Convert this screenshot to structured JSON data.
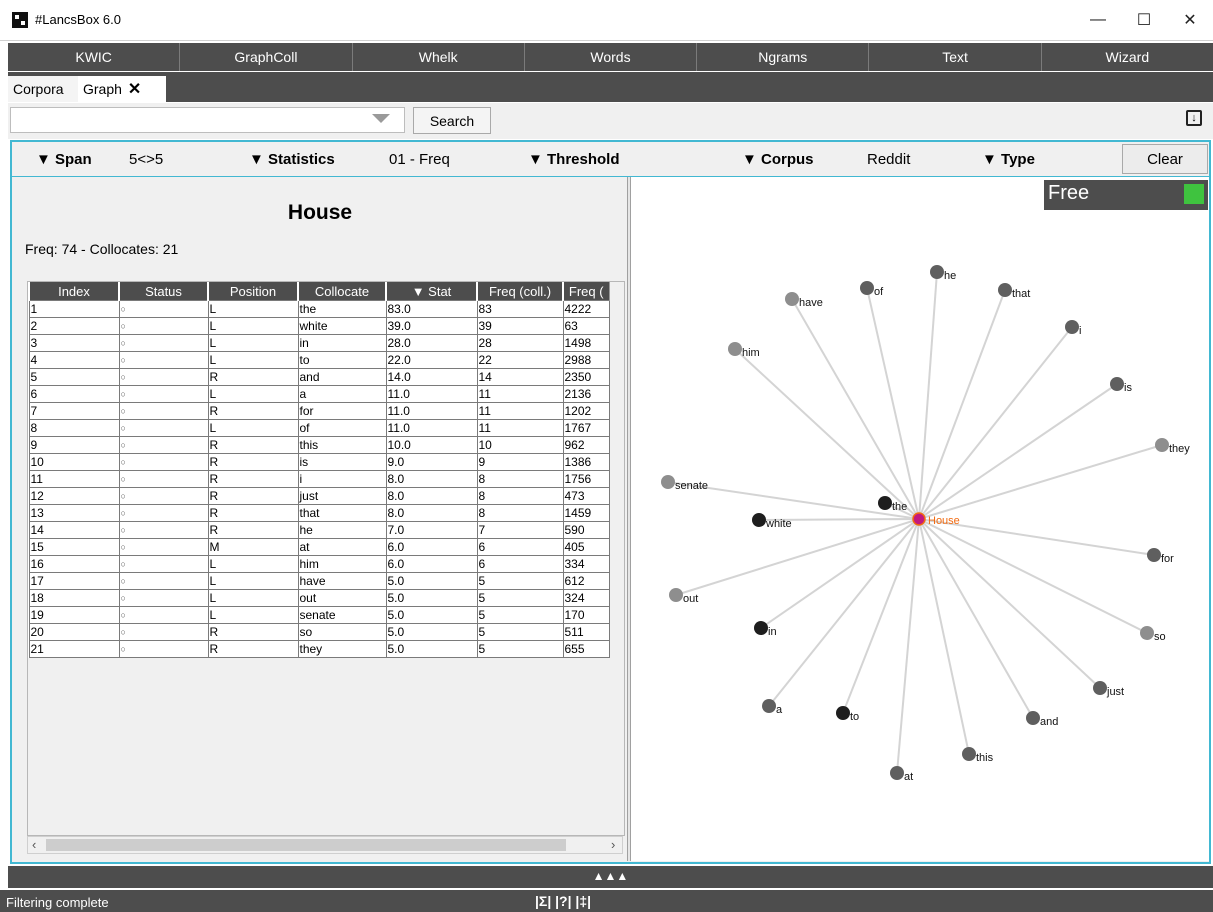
{
  "window": {
    "title": "#LancsBox 6.0",
    "minimize": "—",
    "maximize": "☐",
    "close": "✕"
  },
  "nav": [
    "KWIC",
    "GraphColl",
    "Whelk",
    "Words",
    "Ngrams",
    "Text",
    "Wizard"
  ],
  "subtabs": {
    "corpora": "Corpora",
    "graph": "Graph",
    "close": "✕"
  },
  "search": {
    "placeholder": "",
    "button": "Search"
  },
  "params": {
    "span_label": "▼ Span",
    "span_value": "5<>5",
    "statistics_label": "▼ Statistics",
    "statistics_value": "01 - Freq",
    "threshold_label": "▼ Threshold",
    "corpus_label": "▼ Corpus",
    "corpus_value": "Reddit",
    "type_label": "▼ Type",
    "clear": "Clear"
  },
  "node": {
    "title": "House",
    "info": "Freq: 74 - Collocates: 21"
  },
  "table": {
    "headers": [
      "Index",
      "Status",
      "Position",
      "Collocate",
      "▼ Stat",
      "Freq (coll.)",
      "Freq ("
    ],
    "rows": [
      [
        "1",
        "○",
        "L",
        "the",
        "83.0",
        "83",
        "4222"
      ],
      [
        "2",
        "○",
        "L",
        "white",
        "39.0",
        "39",
        "63"
      ],
      [
        "3",
        "○",
        "L",
        "in",
        "28.0",
        "28",
        "1498"
      ],
      [
        "4",
        "○",
        "L",
        "to",
        "22.0",
        "22",
        "2988"
      ],
      [
        "5",
        "○",
        "R",
        "and",
        "14.0",
        "14",
        "2350"
      ],
      [
        "6",
        "○",
        "L",
        "a",
        "11.0",
        "11",
        "2136"
      ],
      [
        "7",
        "○",
        "R",
        "for",
        "11.0",
        "11",
        "1202"
      ],
      [
        "8",
        "○",
        "L",
        "of",
        "11.0",
        "11",
        "1767"
      ],
      [
        "9",
        "○",
        "R",
        "this",
        "10.0",
        "10",
        "962"
      ],
      [
        "10",
        "○",
        "R",
        "is",
        "9.0",
        "9",
        "1386"
      ],
      [
        "11",
        "○",
        "R",
        "i",
        "8.0",
        "8",
        "1756"
      ],
      [
        "12",
        "○",
        "R",
        "just",
        "8.0",
        "8",
        "473"
      ],
      [
        "13",
        "○",
        "R",
        "that",
        "8.0",
        "8",
        "1459"
      ],
      [
        "14",
        "○",
        "R",
        "he",
        "7.0",
        "7",
        "590"
      ],
      [
        "15",
        "○",
        "M",
        "at",
        "6.0",
        "6",
        "405"
      ],
      [
        "16",
        "○",
        "L",
        "him",
        "6.0",
        "6",
        "334"
      ],
      [
        "17",
        "○",
        "L",
        "have",
        "5.0",
        "5",
        "612"
      ],
      [
        "18",
        "○",
        "L",
        "out",
        "5.0",
        "5",
        "324"
      ],
      [
        "19",
        "○",
        "L",
        "senate",
        "5.0",
        "5",
        "170"
      ],
      [
        "20",
        "○",
        "R",
        "so",
        "5.0",
        "5",
        "511"
      ],
      [
        "21",
        "○",
        "R",
        "they",
        "5.0",
        "5",
        "655"
      ]
    ]
  },
  "graph": {
    "mode_label": "Free",
    "center": "House",
    "collocates": [
      "the",
      "white",
      "in",
      "to",
      "and",
      "a",
      "for",
      "of",
      "this",
      "is",
      "i",
      "just",
      "that",
      "he",
      "at",
      "him",
      "have",
      "out",
      "senate",
      "so",
      "they"
    ],
    "colors": {
      "node_dark": "#1e1e1e",
      "node_mid": "#5f5f5f",
      "node_light": "#8e8e8e",
      "center": "#c2187f",
      "center_ring": "#f26a10",
      "edge": "#d4d4d4",
      "mode_swatch": "#3fc33f"
    }
  },
  "bottom": {
    "expand": "▲▲▲",
    "status": "Filtering complete",
    "icons": "|Σ| |?| |‡|"
  }
}
